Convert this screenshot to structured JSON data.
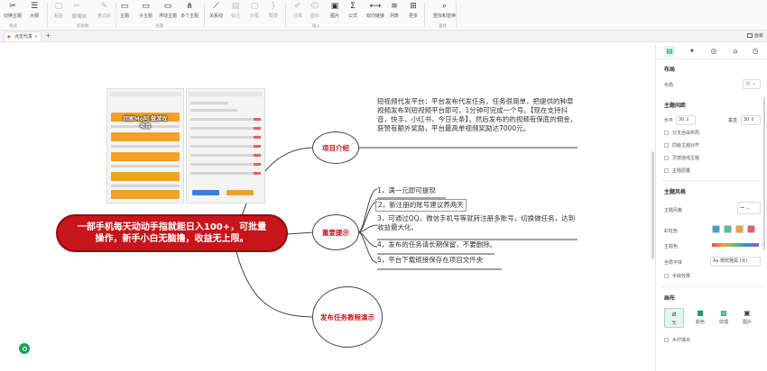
{
  "ribbon": {
    "buttons": [
      {
        "name": "theme-switch",
        "label": "切换主题",
        "icon": "✂",
        "active": true
      },
      {
        "name": "outline",
        "label": "大纲",
        "icon": "☰",
        "active": true
      },
      {
        "name": "paste",
        "label": "粘贴",
        "icon": "▢",
        "dim": true
      },
      {
        "name": "cut",
        "label": "剪切",
        "icon": "✂",
        "dim": true
      },
      {
        "name": "copy",
        "label": "复制",
        "icon": "⧉",
        "dim": true
      },
      {
        "name": "format-painter",
        "label": "格式刷",
        "icon": "✎",
        "dim": true
      },
      {
        "name": "topic",
        "label": "主题",
        "icon": "▭",
        "active": true
      },
      {
        "name": "subtopic",
        "label": "子主题",
        "icon": "▭",
        "active": true
      },
      {
        "name": "floating-topic",
        "label": "浮动主题",
        "icon": "▭",
        "active": true
      },
      {
        "name": "multi-topic",
        "label": "多个主题",
        "icon": "⋔",
        "active": true
      },
      {
        "name": "relationship",
        "label": "关系线",
        "icon": "⟋",
        "active": true
      },
      {
        "name": "label",
        "label": "标注",
        "icon": "▤",
        "dim": true
      },
      {
        "name": "outline-box",
        "label": "外框",
        "icon": "▢",
        "dim": true
      },
      {
        "name": "summary",
        "label": "概要",
        "icon": "}",
        "dim": true
      },
      {
        "name": "note",
        "label": "注释",
        "icon": "✐",
        "dim": true
      },
      {
        "name": "icon-insert",
        "label": "图标",
        "icon": "☺",
        "dim": true
      },
      {
        "name": "image",
        "label": "图片",
        "icon": "▣",
        "active": true
      },
      {
        "name": "formula",
        "label": "公式",
        "icon": "Σ",
        "active": true
      },
      {
        "name": "bidirectional-link",
        "label": "双向链接",
        "icon": "⟷",
        "active": true
      },
      {
        "name": "list",
        "label": "列表",
        "icon": "≡",
        "active": true
      },
      {
        "name": "more",
        "label": "更多",
        "icon": "⊞",
        "active": true
      },
      {
        "name": "find-replace",
        "label": "查找和替换",
        "icon": "⌕",
        "active": true
      }
    ],
    "groups": [
      "格式",
      "剪贴板",
      "主题",
      "插入",
      "查找"
    ]
  },
  "tabbar": {
    "tab_label": "点击代发",
    "close_symbol": "×",
    "add_symbol": "+",
    "panel_toggle_label": "面板"
  },
  "mindmap": {
    "root": "一部手机每天动动手指就能日入100+，可批量操作，新手小白无脑撸，收益无上限。",
    "image_overlay": "回家Mo阿 做游戏项目",
    "branches": [
      {
        "title": "项目介绍"
      },
      {
        "title": "重要提示"
      },
      {
        "title": "发布任务教程演示"
      }
    ],
    "intro_text": "短视频代发平台：平台发布代发任务，任务很简单，把提供的种草视频发布到短视频平台即可，1分钟可完成一个号。【现在支持抖音，快手，小红书，今日头条】，然后发布的的视频有保底的佣金，获赞有额外奖励，平台最高单视频奖励达7000元。",
    "tips": [
      "1，满一元即可提现",
      "2，新注册的账号建议养两天",
      "3，可通过QQ，微信手机号等就转注册多账号，切换做任务，达到收益最大化。",
      "4，发布的任务请长期保留，不要删除。",
      "5，平台下载链接保存在项目文件夹"
    ]
  },
  "panel": {
    "section_layout": "布局",
    "layout_label": "布局",
    "section_spacing": "主题间距",
    "horizontal_label": "水平",
    "horizontal_value": "30",
    "vertical_label": "垂直",
    "vertical_value": "30",
    "checkboxes_1": [
      "分支自由布局",
      "同级主题对齐",
      "灵感连线主题",
      "主题层叠"
    ],
    "section_style": "主题风格",
    "style_label": "主题风格",
    "rainbow_label": "彩虹色",
    "theme_color_label": "主题色",
    "font_label": "全局字体",
    "font_value": "Aa 微软雅黑 (大)",
    "hand_drawn_label": "手绘效果",
    "section_background": "画布",
    "bg_options": [
      {
        "label": "无",
        "icon": "⌀"
      },
      {
        "label": "颜色",
        "icon": "■"
      },
      {
        "label": "纹理",
        "icon": "▩"
      },
      {
        "label": "图片",
        "icon": "▣"
      }
    ],
    "watermark_label": "水印填充",
    "colors": {
      "accent": "#18a058",
      "root_red": "#c8141b",
      "rainbow": [
        "#3aa0d8",
        "#5bbf8a",
        "#f0a441",
        "#e0606a"
      ],
      "theme_bar": [
        "#e05050",
        "#f0a040",
        "#5bbf6a",
        "#3a8ad8",
        "#9a5ad8"
      ]
    }
  }
}
